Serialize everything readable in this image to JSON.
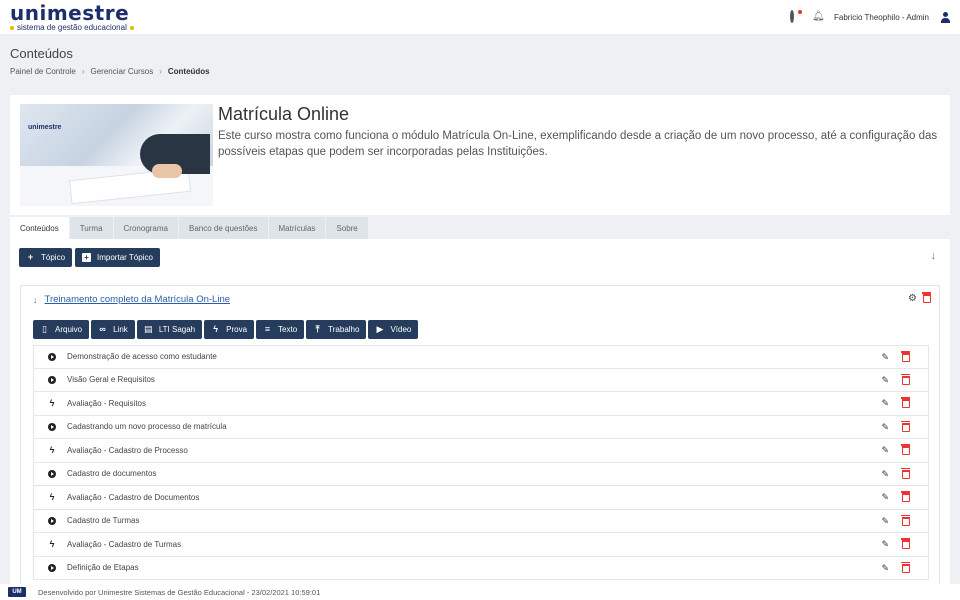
{
  "header": {
    "logo_text": "unimestre",
    "logo_tagline": "sistema de gestão educacional",
    "user_name": "Fabricio Theophilo - Admin"
  },
  "page": {
    "title": "Conteúdos",
    "breadcrumb": [
      "Painel de Controle",
      "Gerenciar Cursos",
      "Conteúdos"
    ]
  },
  "course": {
    "image_brand": "unimestre",
    "title": "Matrícula Online",
    "description": "Este curso mostra como funciona o módulo Matrícula On-Line, exemplificando desde a criação de um novo processo, até a configuração das possíveis etapas que podem ser incorporadas pelas Instituições."
  },
  "tabs": [
    {
      "label": "Conteúdos",
      "active": true
    },
    {
      "label": "Turma",
      "active": false
    },
    {
      "label": "Cronograma",
      "active": false
    },
    {
      "label": "Banco de questões",
      "active": false
    },
    {
      "label": "Matrículas",
      "active": false
    },
    {
      "label": "Sobre",
      "active": false
    }
  ],
  "toolbar": {
    "topic_label": "Tópico",
    "import_label": "Importar Tópico"
  },
  "topic": {
    "title": "Treinamento completo da Matrícula On-Line",
    "add_buttons": [
      "Arquivo",
      "Link",
      "LTI Sagah",
      "Prova",
      "Texto",
      "Trabalho",
      "Vídeo"
    ],
    "items": [
      {
        "type": "video",
        "label": "Demonstração de acesso como estudante"
      },
      {
        "type": "video",
        "label": "Visão Geral e Requisitos"
      },
      {
        "type": "prova",
        "label": "Avaliação - Requisitos"
      },
      {
        "type": "video",
        "label": "Cadastrando um novo processo de matrícula"
      },
      {
        "type": "prova",
        "label": "Avaliação - Cadastro de Processo"
      },
      {
        "type": "video",
        "label": "Cadastro de documentos"
      },
      {
        "type": "prova",
        "label": "Avaliação - Cadastro de Documentos"
      },
      {
        "type": "video",
        "label": "Cadastro de Turmas"
      },
      {
        "type": "prova",
        "label": "Avaliação - Cadastro de Turmas"
      },
      {
        "type": "video",
        "label": "Definição de Etapas"
      }
    ]
  },
  "footer": {
    "logo": "UM",
    "text": "Desenvolvido por Unimestre Sistemas de Gestão Educacional - 23/02/2021 10:59:01"
  }
}
